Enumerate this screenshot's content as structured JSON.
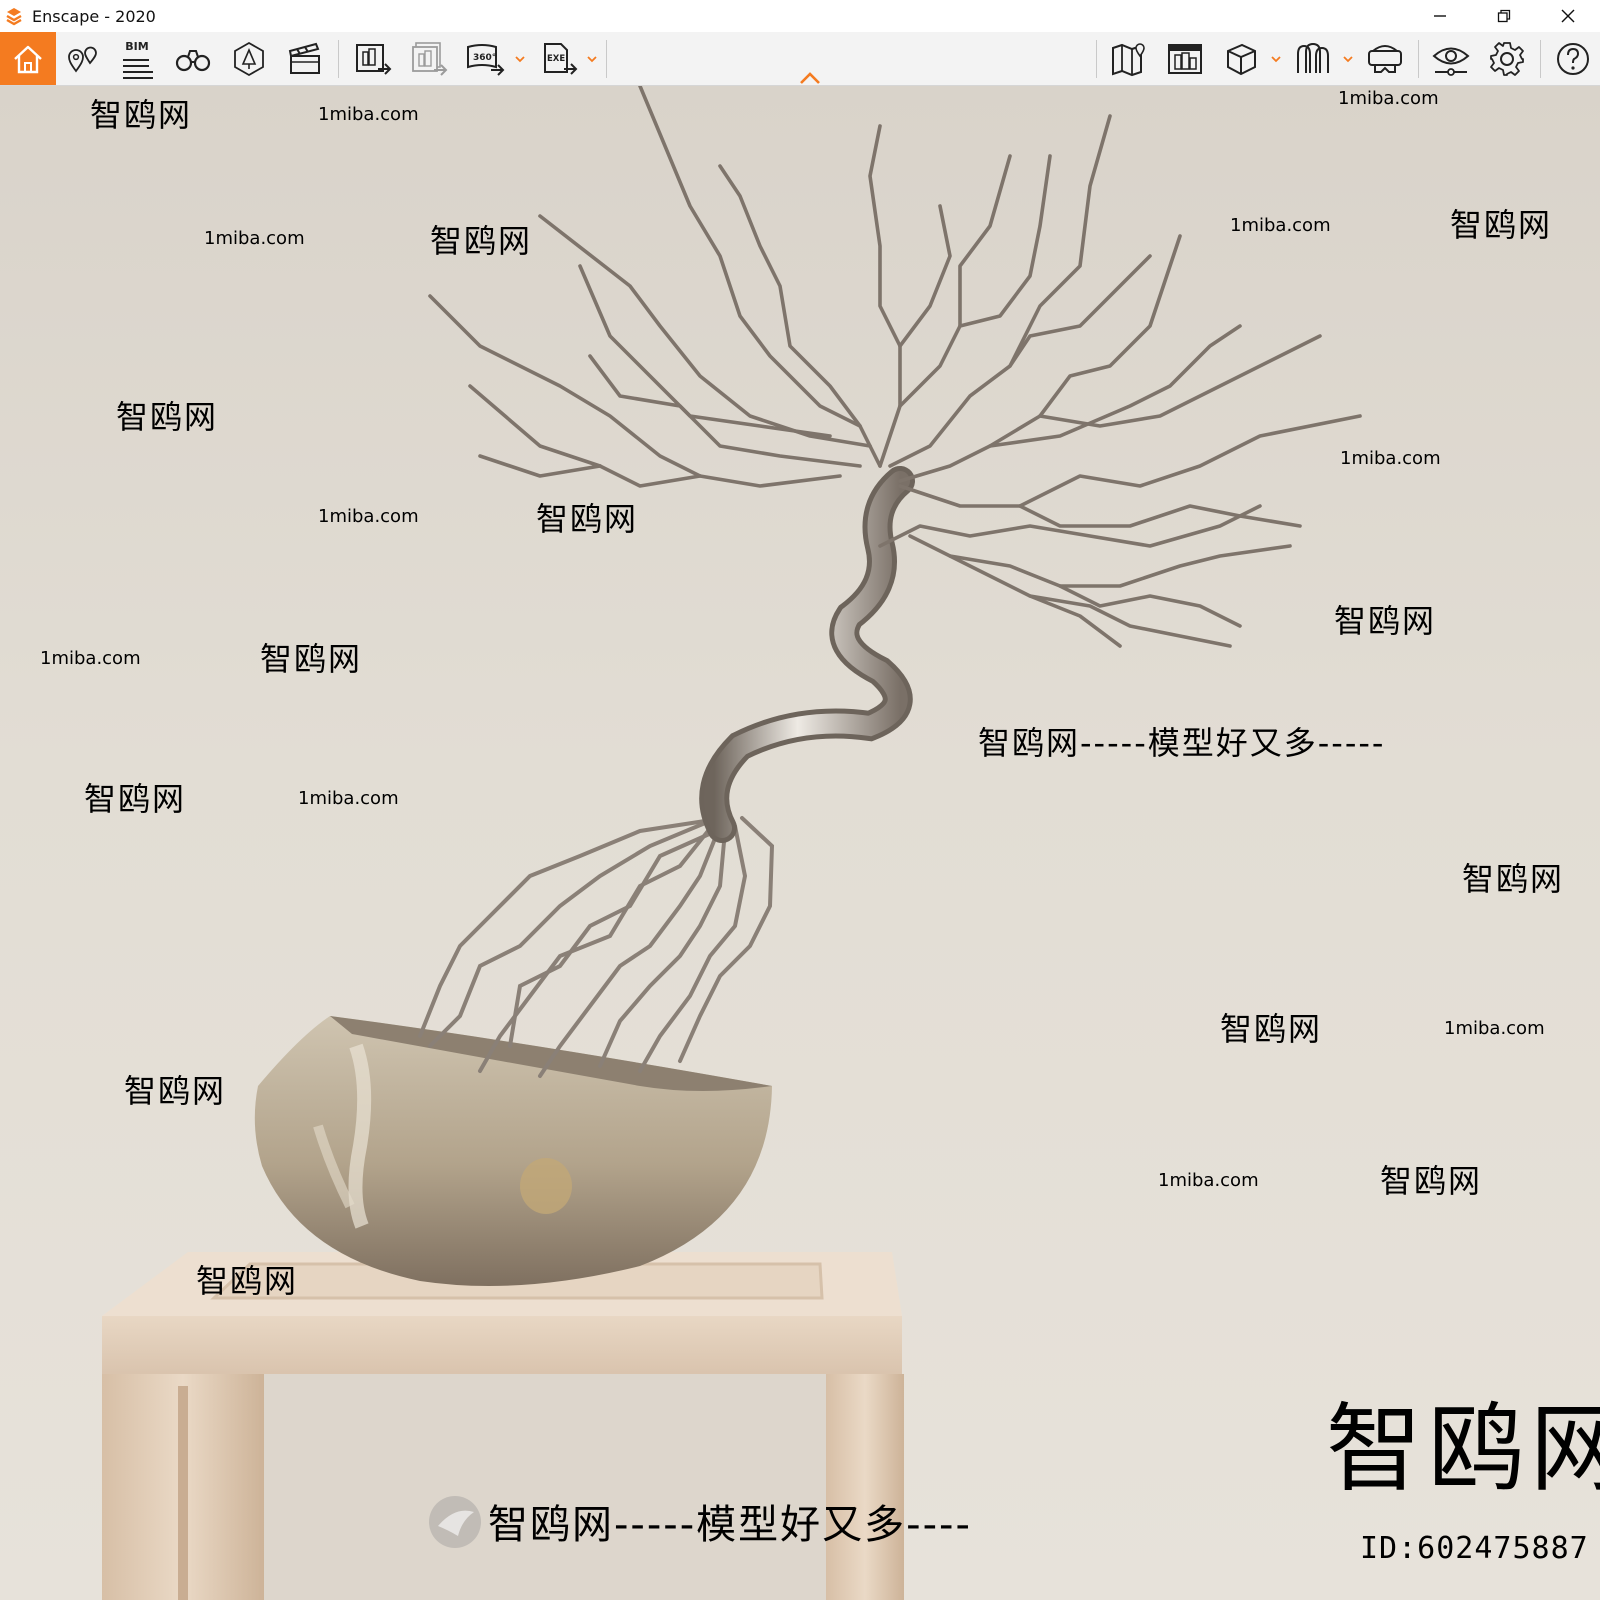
{
  "window": {
    "title": "Enscape - 2020",
    "accent_color": "#f47b20",
    "controls": [
      "minimize-icon",
      "restore-icon",
      "close-icon"
    ]
  },
  "toolbar": {
    "left_group": [
      {
        "icon": "home-icon",
        "active": true
      },
      {
        "icon": "location-pin-icon"
      },
      {
        "icon": "bim-icon",
        "label": "BIM"
      },
      {
        "icon": "binoculars-icon"
      },
      {
        "icon": "light-view-icon"
      },
      {
        "icon": "clapperboard-icon"
      }
    ],
    "export_group": [
      {
        "icon": "render-image-icon"
      },
      {
        "icon": "batch-render-icon"
      },
      {
        "icon": "panorama-360-icon",
        "label": "360°"
      },
      {
        "icon": "export-exe-icon",
        "label": "EXE"
      }
    ],
    "right_group": [
      {
        "icon": "map-icon"
      },
      {
        "icon": "asset-library-icon"
      },
      {
        "icon": "cube-icon"
      },
      {
        "icon": "material-icon"
      },
      {
        "icon": "vr-headset-icon"
      },
      {
        "icon": "eye-settings-icon"
      },
      {
        "icon": "gear-icon"
      },
      {
        "icon": "help-icon"
      }
    ]
  },
  "watermarks": {
    "site_small": "1miba.com",
    "site_cn": "智鸥网",
    "slogan": "智鸥网-----模型好又多----",
    "slogan_mid": "智鸥网-----模型好又多-----",
    "big_logo": "智鸥网",
    "id_label": "ID:602475887"
  }
}
